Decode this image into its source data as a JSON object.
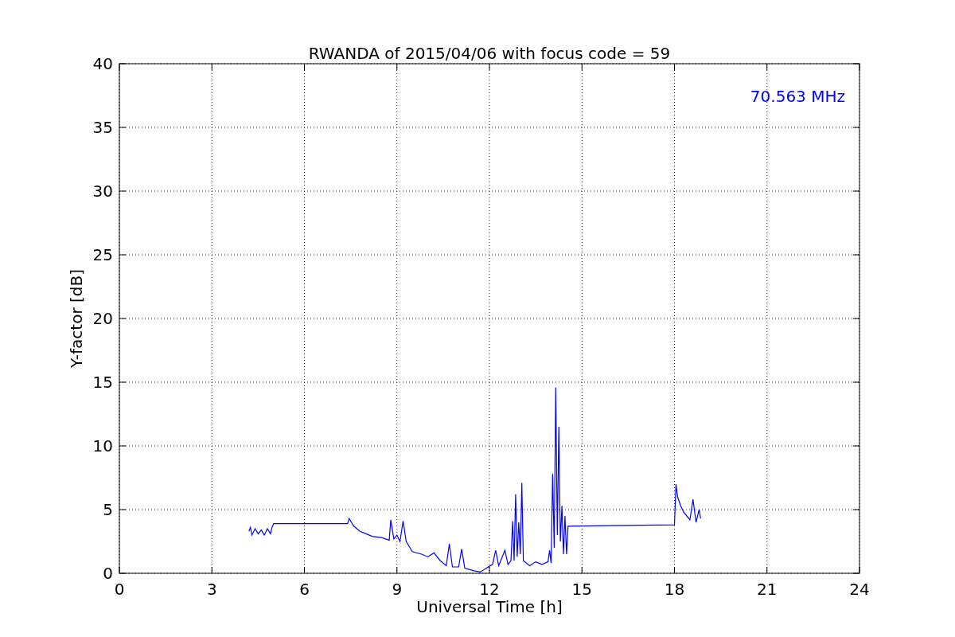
{
  "chart_data": {
    "type": "line",
    "title": "RWANDA of 2015/04/06 with focus code = 59",
    "xlabel": "Universal Time [h]",
    "ylabel": "Y-factor [dB]",
    "xlim": [
      0,
      24
    ],
    "ylim": [
      0,
      40
    ],
    "xticks": [
      0,
      3,
      6,
      9,
      12,
      15,
      18,
      21,
      24
    ],
    "yticks": [
      0,
      5,
      10,
      15,
      20,
      25,
      30,
      35,
      40
    ],
    "x": [
      4.2,
      4.25,
      4.3,
      4.4,
      4.5,
      4.6,
      4.7,
      4.8,
      4.9,
      4.95,
      5.0,
      7.4,
      7.45,
      7.6,
      7.8,
      8.0,
      8.2,
      8.5,
      8.75,
      8.8,
      8.9,
      9.0,
      9.1,
      9.2,
      9.3,
      9.5,
      9.8,
      10.0,
      10.2,
      10.4,
      10.6,
      10.7,
      10.8,
      11.0,
      11.1,
      11.2,
      11.5,
      11.7,
      11.9,
      12.1,
      12.2,
      12.3,
      12.5,
      12.6,
      12.7,
      12.75,
      12.8,
      12.85,
      12.9,
      12.95,
      13.0,
      13.05,
      13.1,
      13.3,
      13.5,
      13.7,
      13.9,
      13.95,
      14.0,
      14.05,
      14.1,
      14.15,
      14.2,
      14.25,
      14.3,
      14.35,
      14.4,
      14.45,
      14.5,
      14.55,
      18.0,
      18.05,
      18.1,
      18.2,
      18.3,
      18.4,
      18.5,
      18.6,
      18.7,
      18.8,
      18.85
    ],
    "series": [
      {
        "name": "70.563 MHz",
        "color": "#0000ff",
        "values": [
          3.3,
          3.6,
          3.0,
          3.5,
          3.1,
          3.4,
          3.0,
          3.5,
          3.1,
          3.6,
          3.9,
          3.9,
          4.3,
          3.7,
          3.3,
          3.1,
          2.9,
          2.8,
          2.6,
          4.2,
          2.7,
          3.0,
          2.5,
          4.1,
          2.5,
          1.7,
          1.5,
          1.3,
          1.6,
          1.0,
          0.6,
          2.3,
          0.5,
          0.5,
          1.9,
          0.4,
          0.2,
          0.1,
          0.4,
          0.7,
          1.8,
          0.6,
          1.8,
          0.7,
          1.0,
          4.1,
          1.0,
          6.2,
          1.3,
          4.0,
          1.5,
          7.1,
          1.0,
          0.6,
          0.9,
          0.7,
          0.9,
          1.8,
          0.8,
          7.8,
          2.0,
          14.6,
          3.0,
          11.5,
          2.5,
          5.3,
          1.5,
          4.5,
          1.5,
          3.7,
          3.8,
          7.0,
          6.0,
          5.3,
          4.8,
          4.5,
          4.2,
          5.8,
          4.0,
          5.0,
          4.3
        ]
      }
    ],
    "grid": true
  }
}
